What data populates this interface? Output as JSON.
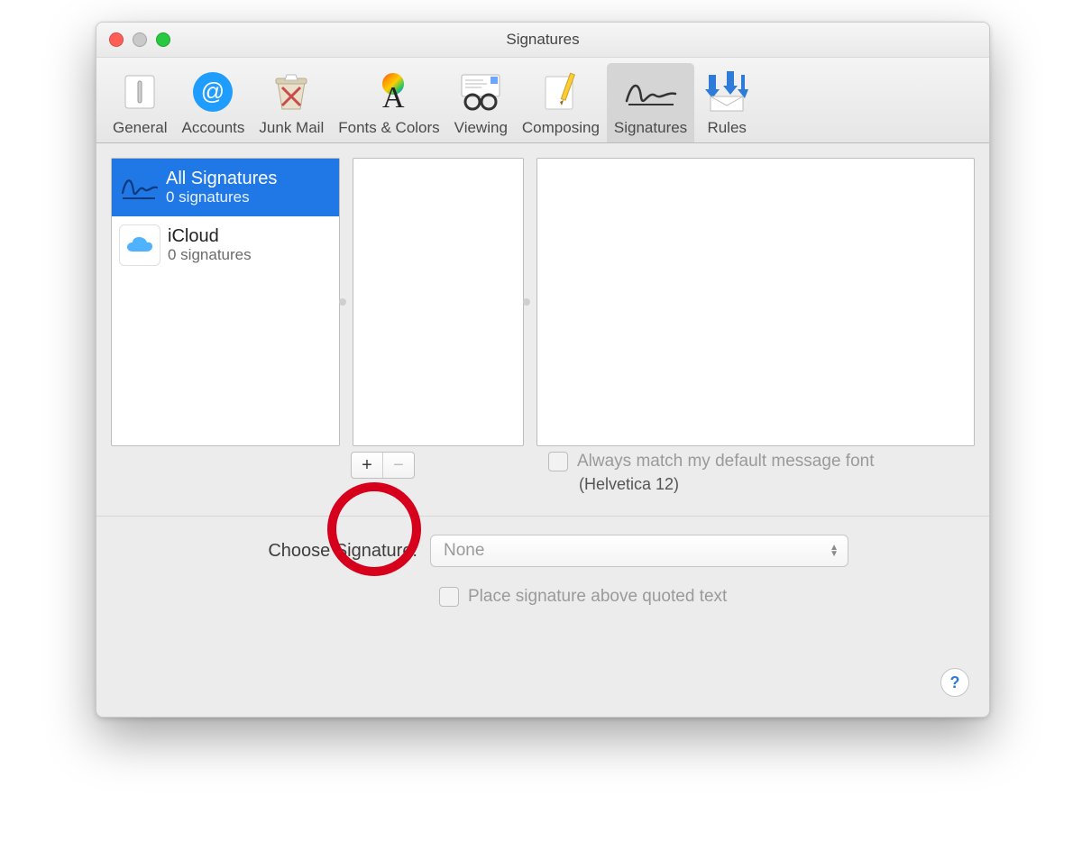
{
  "window": {
    "title": "Signatures"
  },
  "toolbar": {
    "items": [
      {
        "label": "General"
      },
      {
        "label": "Accounts"
      },
      {
        "label": "Junk Mail"
      },
      {
        "label": "Fonts & Colors"
      },
      {
        "label": "Viewing"
      },
      {
        "label": "Composing"
      },
      {
        "label": "Signatures"
      },
      {
        "label": "Rules"
      }
    ],
    "selected_index": 6
  },
  "accounts": [
    {
      "title": "All Signatures",
      "subtitle": "0 signatures",
      "selected": true
    },
    {
      "title": "iCloud",
      "subtitle": "0 signatures",
      "selected": false
    }
  ],
  "add_remove": {
    "add_label": "+",
    "remove_label": "−"
  },
  "match_font": {
    "checkbox_label": "Always match my default message font",
    "detail": "(Helvetica 12)"
  },
  "choose_signature": {
    "label": "Choose Signature:",
    "value": "None"
  },
  "place_above": {
    "label": "Place signature above quoted text"
  },
  "help": {
    "label": "?"
  }
}
